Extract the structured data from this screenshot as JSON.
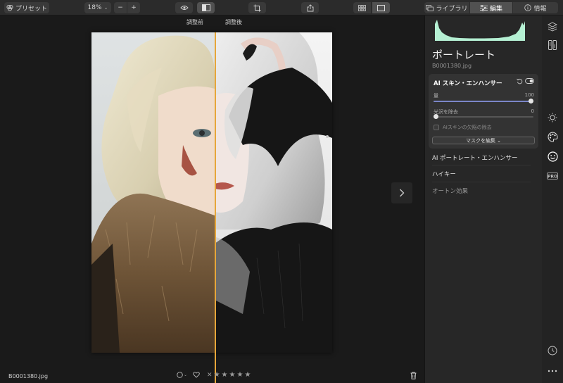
{
  "toolbar": {
    "presets_label": "プリセット",
    "zoom_label": "18%",
    "zoom_minus": "−",
    "zoom_plus": "+",
    "library_label": "ライブラリ",
    "edit_label": "編集",
    "info_label": "情報"
  },
  "canvas": {
    "before_label": "調整前",
    "after_label": "調整後",
    "filename": "B0001380.jpg",
    "rating_stars": [
      "★",
      "★",
      "★",
      "★",
      "★"
    ],
    "reject_glyph": "✕"
  },
  "panel": {
    "title": "ポートレート",
    "filename": "B0001380.jpg",
    "card": {
      "title": "AI スキン・エンハンサー",
      "amount_label": "量",
      "amount_value": "100",
      "amount_fraction": 1.0,
      "shine_label": "光沢を除去",
      "shine_value": "0",
      "shine_fraction": 0.0,
      "defect_label": "AIスキンの欠陥の除去",
      "mask_button": "マスクを編集 ⌄"
    },
    "tools": [
      {
        "label": "AI ポートレート・エンハンサー"
      },
      {
        "label": "ハイキー"
      },
      {
        "label": "オートン効果"
      }
    ]
  },
  "colors": {
    "accent_split": "#e6a63a",
    "slider_fill": "#7b86c8",
    "histogram": "#b5f0d3"
  },
  "icons": [
    "presets-icon",
    "eye-icon",
    "compare-icon",
    "crop-icon",
    "share-icon",
    "grid-view-icon",
    "single-view-icon",
    "library-icon",
    "edit-sliders-icon",
    "info-icon",
    "layers-icon",
    "rail-icon",
    "sun-icon",
    "palette-icon",
    "smile-icon",
    "pro-icon",
    "history-icon",
    "more-icon",
    "reset-icon",
    "toggle-icon",
    "chevron-right-icon",
    "trash-icon",
    "heart-icon",
    "circle-icon"
  ]
}
